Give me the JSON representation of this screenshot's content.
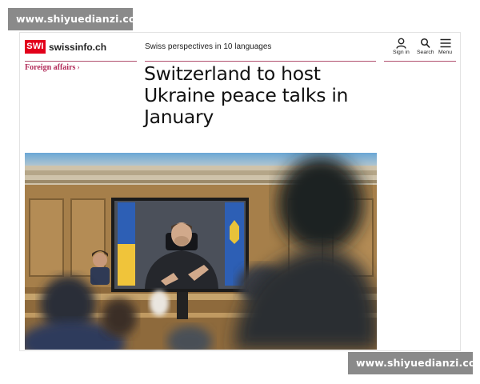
{
  "watermark": {
    "text": "www.shiyuedianzi.com"
  },
  "header": {
    "logo_mark": "SWI",
    "logo_name": "swissinfo.ch",
    "tagline": "Swiss perspectives in 10 languages",
    "nav": {
      "signin_label": "Sign in",
      "search_label": "Search",
      "menu_label": "Menu"
    }
  },
  "article": {
    "category": "Foreign affairs",
    "category_chevron": "›",
    "headline": "Switzerland to host Ukraine peace talks in January"
  },
  "colors": {
    "brand_red": "#e2001a",
    "accent_magenta": "#b22b59",
    "rule": "#b0506e",
    "wood": "#a9824e",
    "screen_bg": "#4b505a"
  },
  "icons": {
    "signin": "person-icon",
    "search": "search-icon",
    "menu": "hamburger-icon",
    "category": "chevron-right-icon"
  }
}
